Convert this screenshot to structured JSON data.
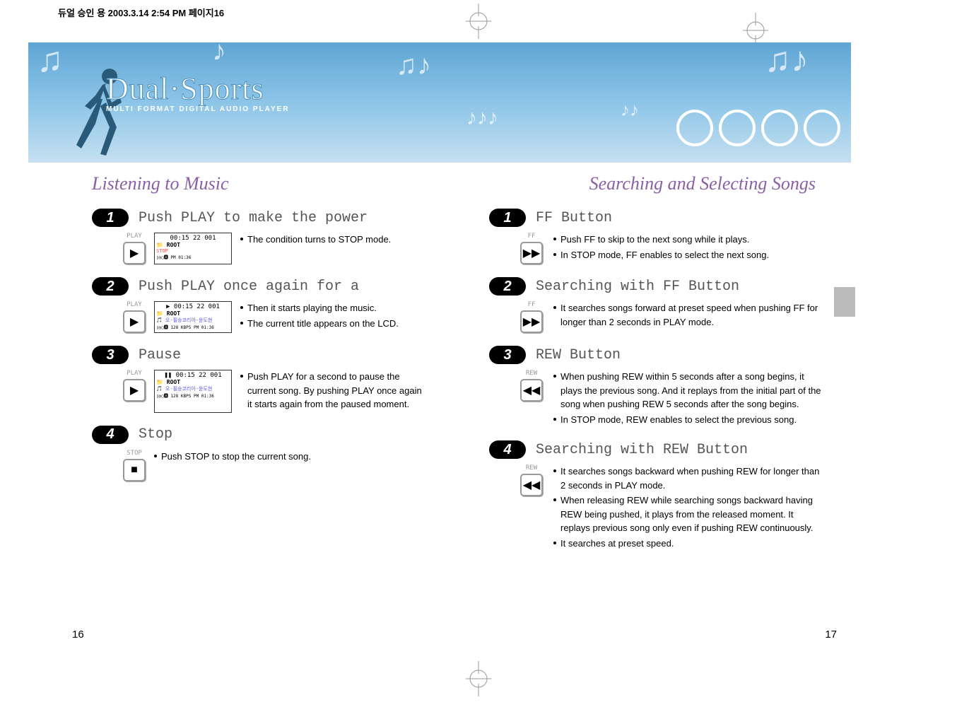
{
  "header_info": "듀얼 승인 용  2003.3.14 2:54 PM 페이지16",
  "product": {
    "title": "Dual·Sports",
    "subtitle": "MULTI FORMAT DIGITAL AUDIO PLAYER"
  },
  "left": {
    "title": "Listening to Music",
    "steps": [
      {
        "num": "1",
        "title": "Push PLAY to make the power",
        "btn_label": "PLAY",
        "btn_icon": "▶",
        "lcd": {
          "time": "00:15  22  001",
          "root": "ROOT",
          "status": "STOP",
          "bottom": "PM 01:36"
        },
        "bullets": [
          "The condition turns to STOP mode."
        ]
      },
      {
        "num": "2",
        "title": "Push PLAY once again for a",
        "btn_label": "PLAY",
        "btn_icon": "▶",
        "lcd": {
          "time": "▶ 00:15  22  001",
          "root": "ROOT",
          "status_blue": "오-필승코리아-윤도현",
          "bottom": "128 KBPS\nPM 01:36"
        },
        "bullets": [
          "Then it starts playing the music.",
          "The current title appears on the LCD."
        ]
      },
      {
        "num": "3",
        "title": "Pause",
        "btn_label": "PLAY",
        "btn_icon": "▶",
        "lcd": {
          "time": "❚❚ 00:15  22  001",
          "root": "ROOT",
          "status_blue": "오-필승코리아-윤도현",
          "bottom": "128 KBPS\nPM 01:36"
        },
        "bullets": [
          "Push PLAY for a second to pause the current song. By pushing PLAY once again it starts again from the paused moment."
        ]
      },
      {
        "num": "4",
        "title": "Stop",
        "btn_label": "STOP",
        "btn_icon": "■",
        "bullets": [
          "Push STOP to stop the current song."
        ]
      }
    ]
  },
  "right": {
    "title": "Searching and Selecting Songs",
    "steps": [
      {
        "num": "1",
        "title": "FF Button",
        "btn_label": "FF",
        "btn_icon": "▶▶",
        "bullets": [
          "Push FF to skip to the next song while it plays.",
          "In STOP mode, FF enables to select the next song."
        ]
      },
      {
        "num": "2",
        "title": "Searching with FF Button",
        "btn_label": "FF",
        "btn_icon": "▶▶",
        "bullets": [
          "It searches songs forward at preset speed when pushing FF for longer than 2 seconds in PLAY mode."
        ]
      },
      {
        "num": "3",
        "title": "REW Button",
        "btn_label": "REW",
        "btn_icon": "◀◀",
        "bullets": [
          "When pushing REW within 5 seconds after a song begins, it plays the previous song. And it replays from the initial part of the song when pushing REW 5 seconds after the song begins.",
          "In STOP mode, REW enables to select the previous song."
        ]
      },
      {
        "num": "4",
        "title": "Searching with REW Button",
        "btn_label": "REW",
        "btn_icon": "◀◀",
        "bullets": [
          "It searches songs backward when pushing REW for longer than 2 seconds in PLAY mode.",
          "When releasing REW while searching songs backward having REW being pushed, it plays from the released moment. It replays previous song only even if pushing REW continuously.",
          "It searches at preset speed."
        ]
      }
    ]
  },
  "page_left": "16",
  "page_right": "17"
}
